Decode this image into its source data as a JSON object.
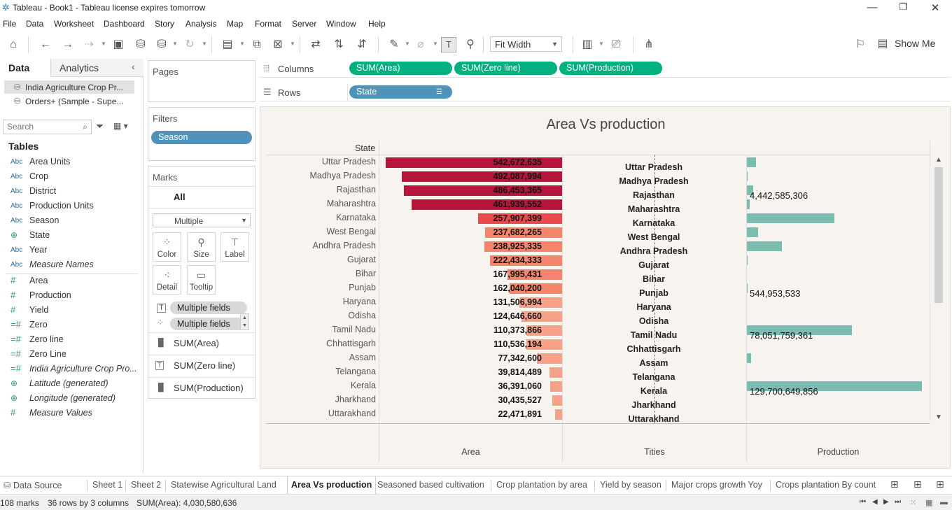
{
  "window": {
    "title": "Tableau - Book1 - Tableau license expires tomorrow",
    "minimize": "—",
    "restore": "❐",
    "close": "✕"
  },
  "menu": [
    "File",
    "Data",
    "Worksheet",
    "Dashboard",
    "Story",
    "Analysis",
    "Map",
    "Format",
    "Server",
    "Window",
    "Help"
  ],
  "toolbar": {
    "fit_label": "Fit Width",
    "show_me": "Show Me"
  },
  "data_pane": {
    "tab_data": "Data",
    "tab_analytics": "Analytics",
    "sources": [
      "India Agriculture Crop Pr...",
      "Orders+ (Sample - Supe..."
    ],
    "search_placeholder": "Search",
    "tables_heading": "Tables",
    "dimensions": [
      {
        "icon": "Abc",
        "label": "Area Units"
      },
      {
        "icon": "Abc",
        "label": "Crop"
      },
      {
        "icon": "Abc",
        "label": "District"
      },
      {
        "icon": "Abc",
        "label": "Production Units"
      },
      {
        "icon": "Abc",
        "label": "Season"
      },
      {
        "icon": "globe",
        "label": "State"
      },
      {
        "icon": "Abc",
        "label": "Year"
      },
      {
        "icon": "Abc",
        "label": "Measure Names"
      }
    ],
    "measures": [
      {
        "icon": "#",
        "label": "Area"
      },
      {
        "icon": "#",
        "label": "Production"
      },
      {
        "icon": "#",
        "label": "Yield"
      },
      {
        "icon": "=#",
        "label": "Zero"
      },
      {
        "icon": "=#",
        "label": "Zero line"
      },
      {
        "icon": "=#",
        "label": "Zero Line"
      },
      {
        "icon": "=#",
        "label": "India Agriculture Crop Pro..."
      },
      {
        "icon": "globe",
        "label": "Latitude (generated)"
      },
      {
        "icon": "globe",
        "label": "Longitude (generated)"
      },
      {
        "icon": "#",
        "label": "Measure Values"
      }
    ]
  },
  "shelves": {
    "pages": "Pages",
    "filters": "Filters",
    "filter_pill": "Season",
    "columns": "Columns",
    "rows": "Rows",
    "column_pills": [
      "SUM(Area)",
      "SUM(Zero line)",
      "SUM(Production)"
    ],
    "row_pill": "State"
  },
  "marks": {
    "title": "Marks",
    "all": "All",
    "type": "Multiple",
    "buttons": [
      "Color",
      "Size",
      "Label",
      "Detail",
      "Tooltip"
    ],
    "fields": [
      "Multiple fields",
      "Multiple fields"
    ],
    "measures": [
      "SUM(Area)",
      "SUM(Zero line)",
      "SUM(Production)"
    ]
  },
  "viz": {
    "title": "Area Vs production",
    "row_header": "State",
    "axis_labels": [
      "Area",
      "Tities",
      "Production"
    ]
  },
  "chart_data": {
    "type": "bar",
    "title": "Area Vs production",
    "categories": [
      "Uttar Pradesh",
      "Madhya Pradesh",
      "Rajasthan",
      "Maharashtra",
      "Karnataka",
      "West Bengal",
      "Andhra Pradesh",
      "Gujarat",
      "Bihar",
      "Punjab",
      "Haryana",
      "Odisha",
      "Tamil Nadu",
      "Chhattisgarh",
      "Assam",
      "Telangana",
      "Kerala",
      "Jharkhand",
      "Uttarakhand"
    ],
    "series": [
      {
        "name": "Area",
        "values": [
          542672635,
          492087994,
          486453365,
          461939552,
          257907399,
          237682265,
          238925335,
          222434333,
          167995431,
          162040200,
          131506994,
          124646660,
          110373866,
          110536194,
          77342600,
          39814489,
          36391060,
          30435527,
          22471891
        ],
        "labels": [
          "542,672,635",
          "492,087,994",
          "486,453,365",
          "461,939,552",
          "257,907,399",
          "237,682,265",
          "238,925,335",
          "222,434,333",
          "167,995,431",
          "162,040,200",
          "131,506,994",
          "124,646,660",
          "110,373,866",
          "110,536,194",
          "77,342,600",
          "39,814,489",
          "36,391,060",
          "30,435,527",
          "22,471,891"
        ]
      },
      {
        "name": "Production",
        "values": [
          6600000000,
          600000000,
          4442585306,
          2000000000,
          65000000000,
          8500000000,
          26000000000,
          400000000,
          0,
          544953533,
          0,
          0,
          78051759361,
          0,
          3200000000,
          0,
          129700649856,
          0,
          0
        ],
        "labels": [
          "",
          "",
          "4,442,585,306",
          "",
          "",
          "",
          "",
          "",
          "",
          "544,953,533",
          "",
          "",
          "78,051,759,361",
          "",
          "",
          "",
          "129,700,649,856",
          "",
          ""
        ]
      }
    ],
    "area_max": 542672635,
    "production_max": 129700649856,
    "colors": {
      "area_high": "#b5163b",
      "area_mid": "#e8494c",
      "area_low": "#f4856c",
      "production": "#7dbdb1"
    }
  },
  "sheet_tabs": [
    "Data Source",
    "Sheet 1",
    "Sheet 2",
    "Statewise Agricultural Land",
    "Area Vs production",
    "Seasoned based cultivation",
    "Crop plantation by area",
    "Yield by season",
    "Major crops growth Yoy",
    "Crops plantation By count"
  ],
  "active_tab": "Area Vs production",
  "status": {
    "marks": "108 marks",
    "rows_cols": "36 rows by 3 columns",
    "sum": "SUM(Area): 4,030,580,636"
  }
}
